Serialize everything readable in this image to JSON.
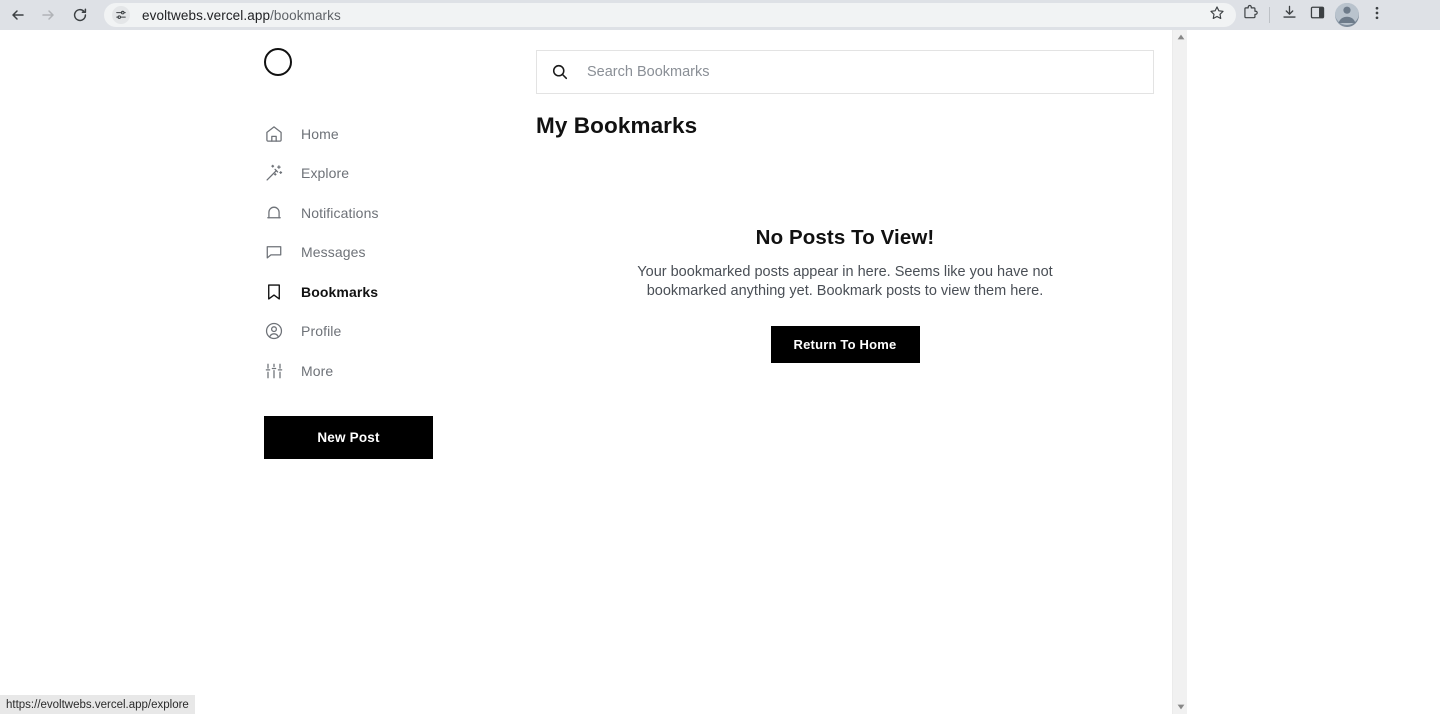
{
  "browser": {
    "back_icon": "arrow-left-icon",
    "forward_icon": "arrow-right-icon",
    "reload_icon": "reload-icon",
    "site_settings_icon": "tune-icon",
    "url_domain": "evoltwebs.vercel.app",
    "url_path": "/bookmarks",
    "star_icon": "star-icon",
    "extensions_icon": "puzzle-piece-icon",
    "download_icon": "download-icon",
    "side_panel_icon": "side-panel-icon",
    "avatar_icon": "profile-avatar-icon",
    "menu_icon": "three-dot-menu-icon",
    "status_url": "https://evoltwebs.vercel.app/explore"
  },
  "sidebar": {
    "logo_name": "brand-logo-circle",
    "items": [
      {
        "label": "Home",
        "icon": "home-icon",
        "active": false
      },
      {
        "label": "Explore",
        "icon": "magic-wand-icon",
        "active": false
      },
      {
        "label": "Notifications",
        "icon": "bell-icon",
        "active": false
      },
      {
        "label": "Messages",
        "icon": "chat-bubble-icon",
        "active": false
      },
      {
        "label": "Bookmarks",
        "icon": "bookmark-icon",
        "active": true
      },
      {
        "label": "Profile",
        "icon": "user-circle-icon",
        "active": false
      },
      {
        "label": "More",
        "icon": "sliders-icon",
        "active": false
      }
    ],
    "new_post_label": "New Post"
  },
  "main": {
    "search_placeholder": "Search Bookmarks",
    "search_value": "",
    "search_icon": "search-icon",
    "page_title": "My Bookmarks",
    "empty_state": {
      "title": "No Posts To View!",
      "description": "Your bookmarked posts appear in here. Seems like you have not bookmarked anything yet. Bookmark posts to view them here.",
      "button_label": "Return To Home"
    }
  },
  "colors": {
    "accent": "#000000",
    "chrome_bg": "#dee1e6",
    "omnibox_bg": "#f1f3f4",
    "muted_text": "#6e7278",
    "border": "#e3e3e3"
  }
}
